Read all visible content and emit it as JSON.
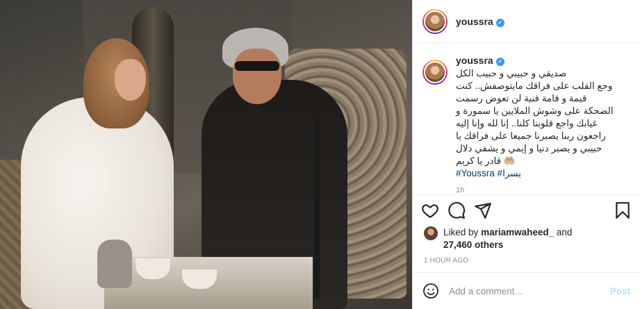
{
  "post": {
    "username": "youssra",
    "verified_icon": "verified-badge-icon",
    "image_alt": "Photo of a woman in a white dress talking to a man with gray hair and dark glasses holding a cane",
    "caption_text": "صديقي و حبيبي و حبيب الكل\nوجع القلب على فراقك مايتوصفش.. كنت\nقيمة و قامة فنية لن تعوض رسمت\nالضحكة على وشوش الملايين يا سمورة و\nغيابك واجع قلوبنا كلنا.. إنا لله وإنا إليه\nراجعون ربنا يصبرنا جميعا على فراقك يا\nحبيبي و يصبر دنيا و إيمي و يشفي دلال\n🤲🏼 قادر يا كريم",
    "hashtags": "#Youssra #يسرا",
    "truncated_time": "1h"
  },
  "actions": {
    "like_icon": "heart-icon",
    "comment_icon": "comment-icon",
    "share_icon": "paper-plane-icon",
    "save_icon": "bookmark-icon"
  },
  "likes": {
    "liked_by_label": "Liked by",
    "liked_by_user": "mariamwaheed_",
    "and_label": "and",
    "count_text": "27,460 others"
  },
  "timestamp": "1 HOUR AGO",
  "comment_box": {
    "emoji_icon": "emoji-icon",
    "placeholder": "Add a comment...",
    "post_label": "Post"
  },
  "colors": {
    "link": "#00376b",
    "verified": "#3897f0",
    "post_disabled": "#b2dffc",
    "muted": "#8e8e8e"
  }
}
